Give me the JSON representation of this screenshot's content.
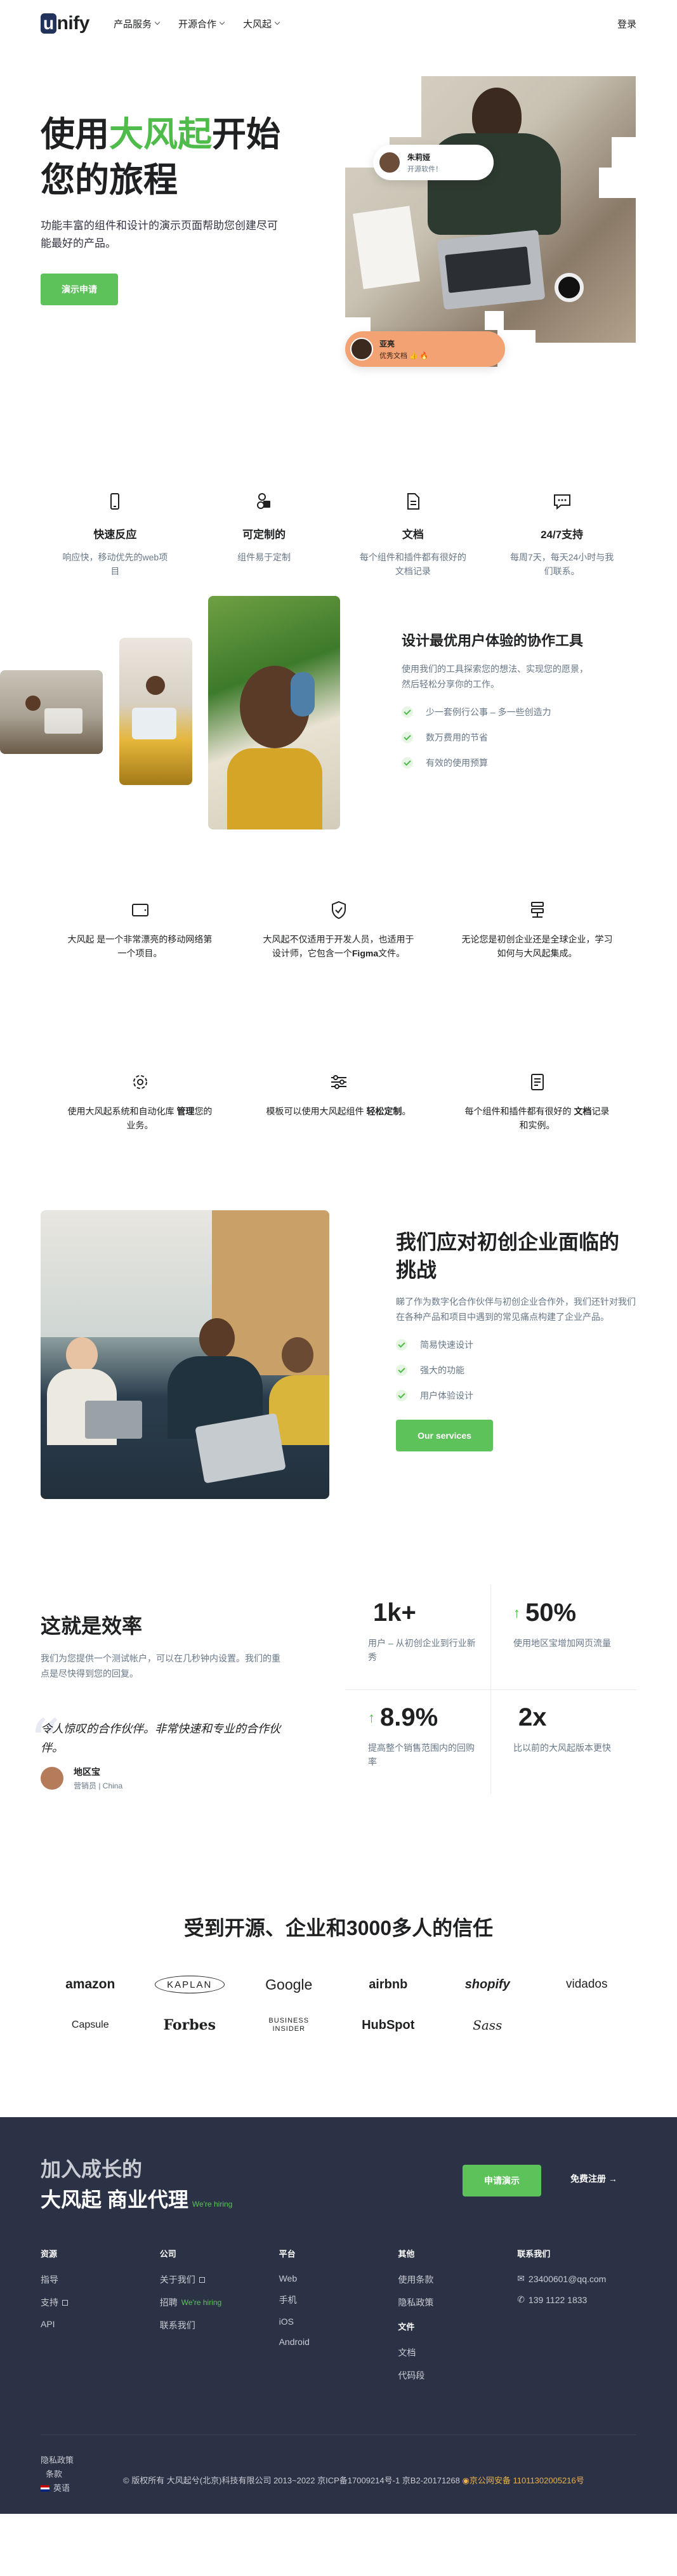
{
  "header": {
    "logo_letter": "u",
    "logo_rest": "nify",
    "nav": [
      "产品服务",
      "开源合作",
      "大风起"
    ],
    "login": "登录"
  },
  "hero": {
    "title_pre": "使用",
    "title_green": "大风起",
    "title_post": "开始您的旅程",
    "desc": "功能丰富的组件和设计的演示页面帮助您创建尽可能最好的产品。",
    "cta": "演示申请",
    "chip1": {
      "name": "朱莉娅",
      "sub": "开源软件！"
    },
    "chip2": {
      "name": "亚亮",
      "sub": "优秀文档 👍 🔥"
    }
  },
  "features": [
    {
      "icon": "phone-icon",
      "title": "快速反应",
      "desc": "响应快，移动优先的web项目"
    },
    {
      "icon": "shapes-icon",
      "title": "可定制的",
      "desc": "组件易于定制"
    },
    {
      "icon": "document-icon",
      "title": "文档",
      "desc": "每个组件和插件都有很好的文档记录"
    },
    {
      "icon": "chat-icon",
      "title": "24/7支持",
      "desc": "每周7天，每天24小时与我们联系。"
    }
  ],
  "collab": {
    "title": "设计最优用户体验的协作工具",
    "desc": "使用我们的工具探索您的想法、实现您的愿景，然后轻松分享你的工作。",
    "checks": [
      "少一套例行公事 – 多一些创造力",
      "数万费用的节省",
      "有效的使用预算"
    ]
  },
  "grid6": [
    {
      "icon": "tablet-icon",
      "pre": "大风起 是一个非常漂亮的移动网络第一个项目。",
      "bold": "",
      "post": ""
    },
    {
      "icon": "shield-icon",
      "pre": "大风起不仅适用于开发人员，也适用于设计师，它包含一个",
      "bold": "Figma",
      "post": "文件。"
    },
    {
      "icon": "network-icon",
      "pre": "无论您是初创企业还是全球企业，学习如何与大风起集成。",
      "bold": "",
      "post": ""
    },
    {
      "icon": "settings-icon",
      "pre": "使用大风起系统和自动化库 ",
      "bold": "管理",
      "post": "您的业务。"
    },
    {
      "icon": "sliders-icon",
      "pre": "模板可以使用大风起组件 ",
      "bold": "轻松定制",
      "post": "。"
    },
    {
      "icon": "notes-icon",
      "pre": "每个组件和插件都有很好的 ",
      "bold": "文档",
      "post": "记录和实例。"
    }
  ],
  "startup": {
    "title": "我们应对初创企业面临的挑战",
    "desc": "睇了作为数字化合作伙伴与初创企业合作外，我们还针对我们在各种产品和项目中遇到的常见痛点构建了企业产品。",
    "checks": [
      "简易快速设计",
      "强大的功能",
      "用户体验设计"
    ],
    "cta": "Our services"
  },
  "efficiency": {
    "title": "这就是效率",
    "desc": "我们为您提供一个测试帐户，可以在几秒钟内设置。我们的重点是尽快得到您的回复。",
    "quote": "令人惊叹的合作伙伴。非常快速和专业的合作伙伴。",
    "author_name": "地区宝",
    "author_role": "营销员 | China",
    "stats": [
      {
        "num": "1k+",
        "arrow": "",
        "label": "用户 – 从初创企业到行业新秀"
      },
      {
        "num": "50%",
        "arrow": "↑",
        "label": "使用地区宝增加网页流量"
      },
      {
        "num": "8.9%",
        "arrow": "↑",
        "label": "提高整个销售范围内的回购率"
      },
      {
        "num": "2x",
        "arrow": "",
        "label": "比以前的大风起版本更快"
      }
    ]
  },
  "trust": {
    "title": "受到开源、企业和3000多人的信任",
    "brands": [
      "amazon",
      "KAPLAN",
      "Google",
      "airbnb",
      "shopify",
      "vidados",
      "Capsule",
      "Forbes",
      "BUSINESS INSIDER",
      "HubSpot",
      "Sass"
    ]
  },
  "footer": {
    "join_line1": "加入成长的",
    "join_line2": "大风起 商业代理",
    "hiring": "We're hiring",
    "cta": "申请演示",
    "register": "免费注册 →",
    "cols": [
      {
        "h": "资源",
        "items": [
          "指导",
          "支持",
          "API"
        ]
      },
      {
        "h": "公司",
        "items": [
          "关于我们",
          "招聘",
          "联系我们"
        ],
        "hiring": "We're hiring"
      },
      {
        "h": "平台",
        "items": [
          "Web",
          "手机",
          "iOS",
          "Android"
        ]
      },
      {
        "h": "其他",
        "items": [
          "使用条款",
          "隐私政策"
        ],
        "h2": "文件",
        "items2": [
          "文档",
          "代码段"
        ]
      },
      {
        "h": "联系我们",
        "items": [
          "23400601@qq.com",
          "139 1122 1833"
        ]
      }
    ],
    "bottom_links": [
      "隐私政策",
      "条款"
    ],
    "lang": "英语",
    "copyright": "© 版权所有 大风起兮(北京)科技有限公司 2013~2022 京ICP备17009214号-1 京B2-20171268",
    "police": "京公网安备 11011302005216号"
  }
}
